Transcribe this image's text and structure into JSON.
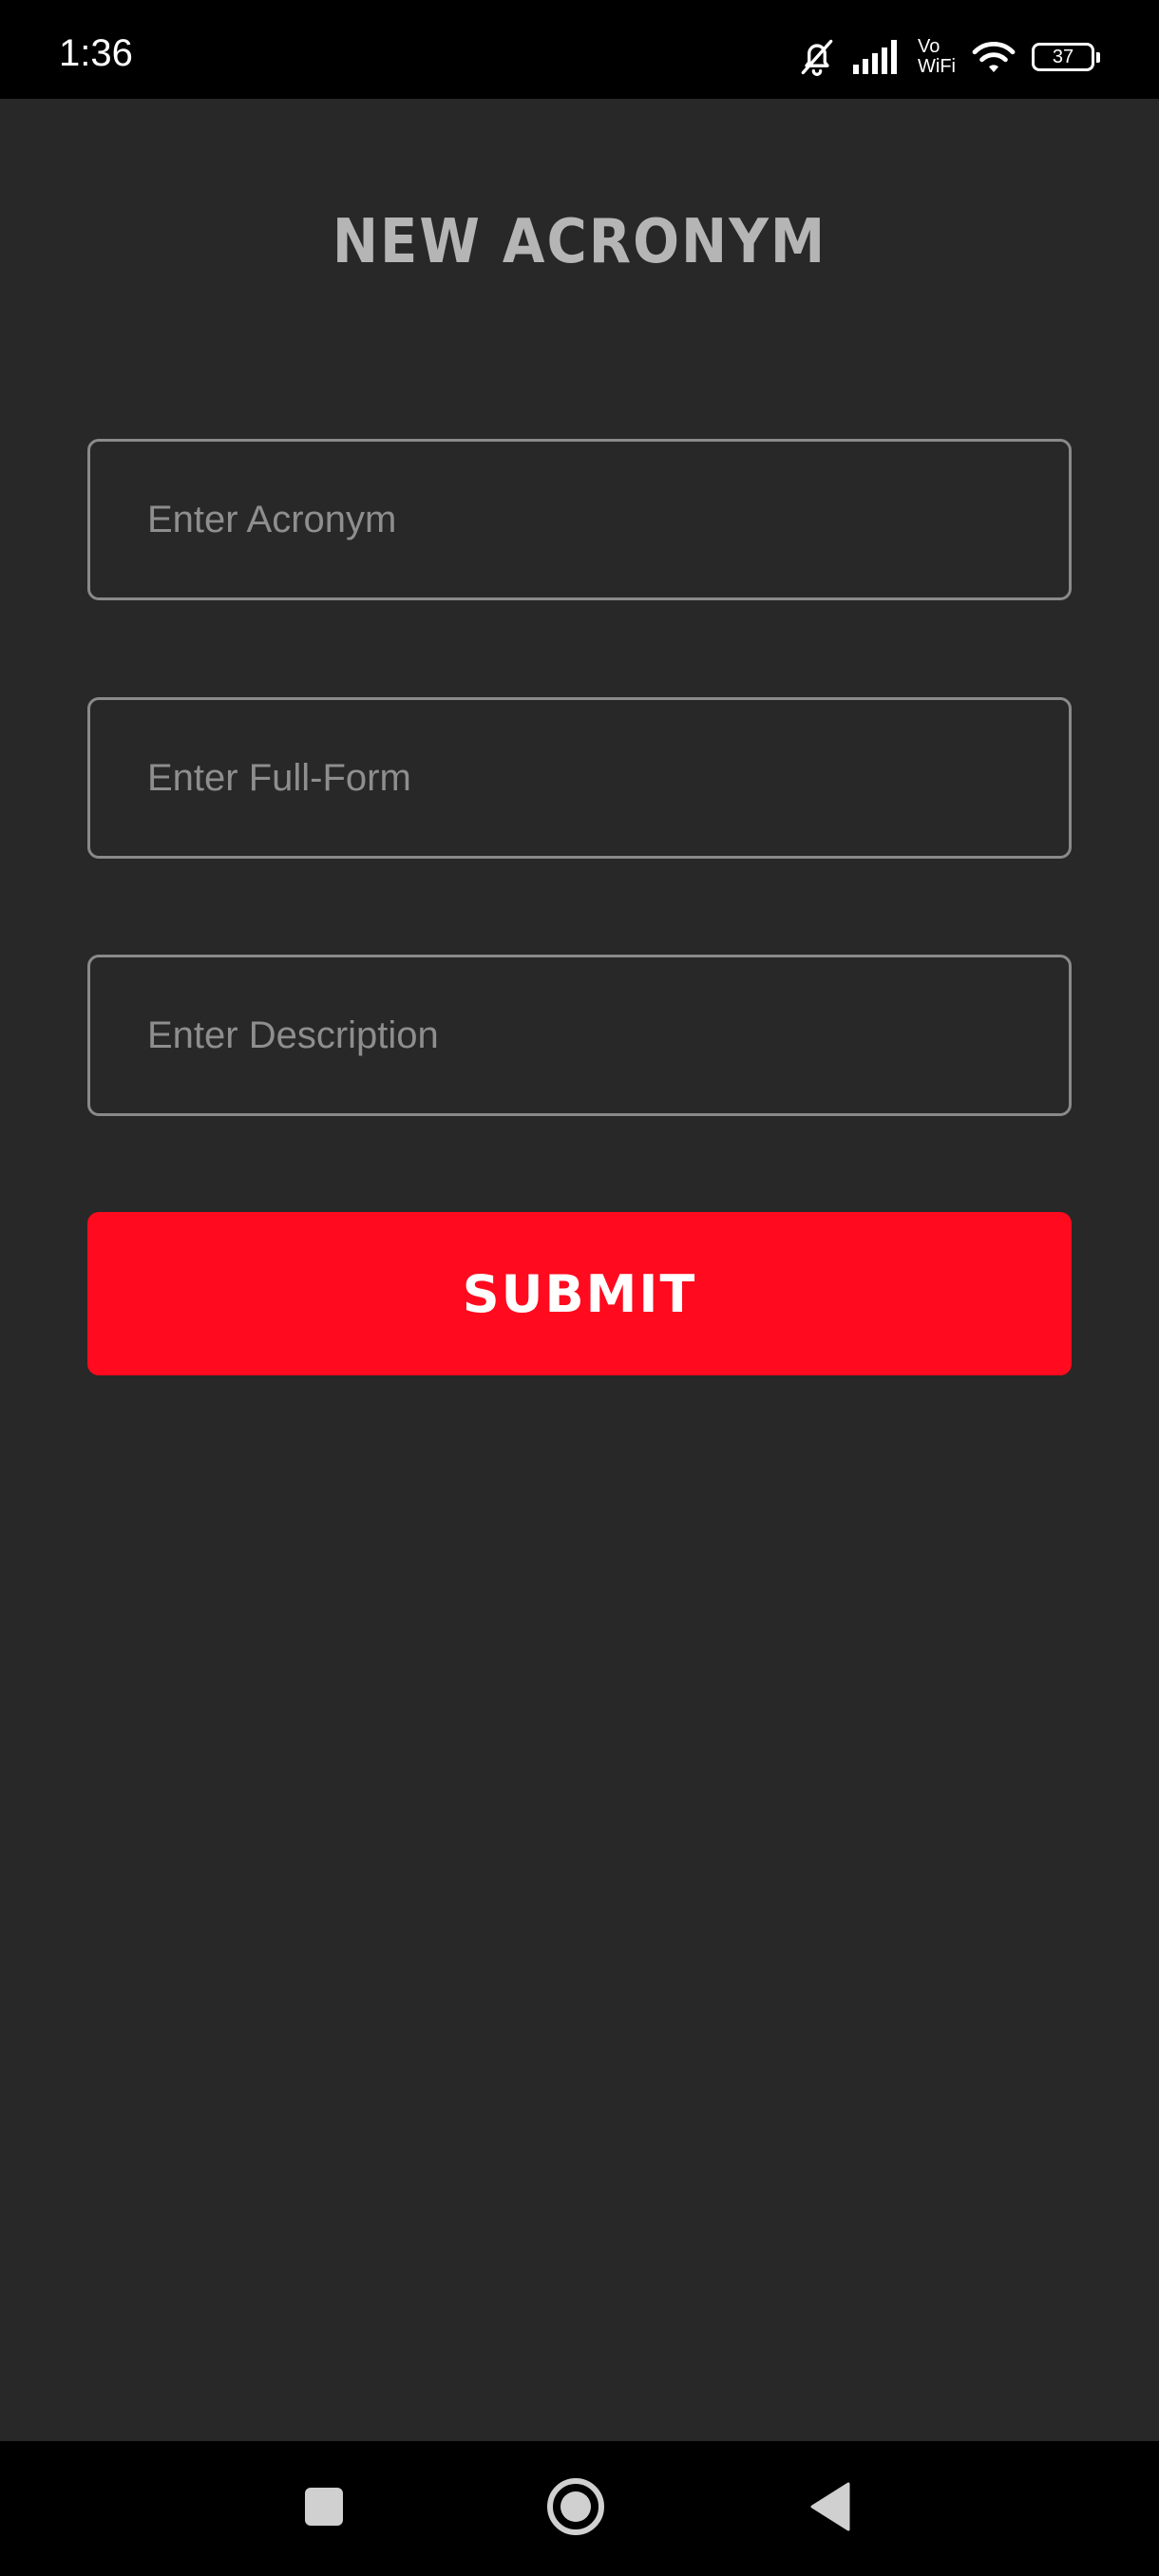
{
  "status_bar": {
    "time": "1:36",
    "vowifi_top": "Vo",
    "vowifi_bottom": "WiFi",
    "battery": "37",
    "icons": [
      "bell-muted-icon",
      "signal-icon",
      "vowifi-icon",
      "wifi-icon",
      "battery-icon"
    ]
  },
  "page": {
    "title": "NEW ACRONYM"
  },
  "form": {
    "acronym_placeholder": "Enter Acronym",
    "acronym_value": "",
    "fullform_placeholder": "Enter Full-Form",
    "fullform_value": "",
    "description_placeholder": "Enter Description",
    "description_value": "",
    "submit_label": "SUBMIT"
  },
  "nav_bar": {
    "icons": [
      "recents-square-icon",
      "home-circle-icon",
      "back-triangle-icon"
    ]
  },
  "colors": {
    "background": "#282828",
    "status_bar": "#000000",
    "title": "#b5b5b5",
    "field_border": "#8a8a8a",
    "placeholder": "#8e8e8e",
    "accent": "#ff0a1e"
  }
}
